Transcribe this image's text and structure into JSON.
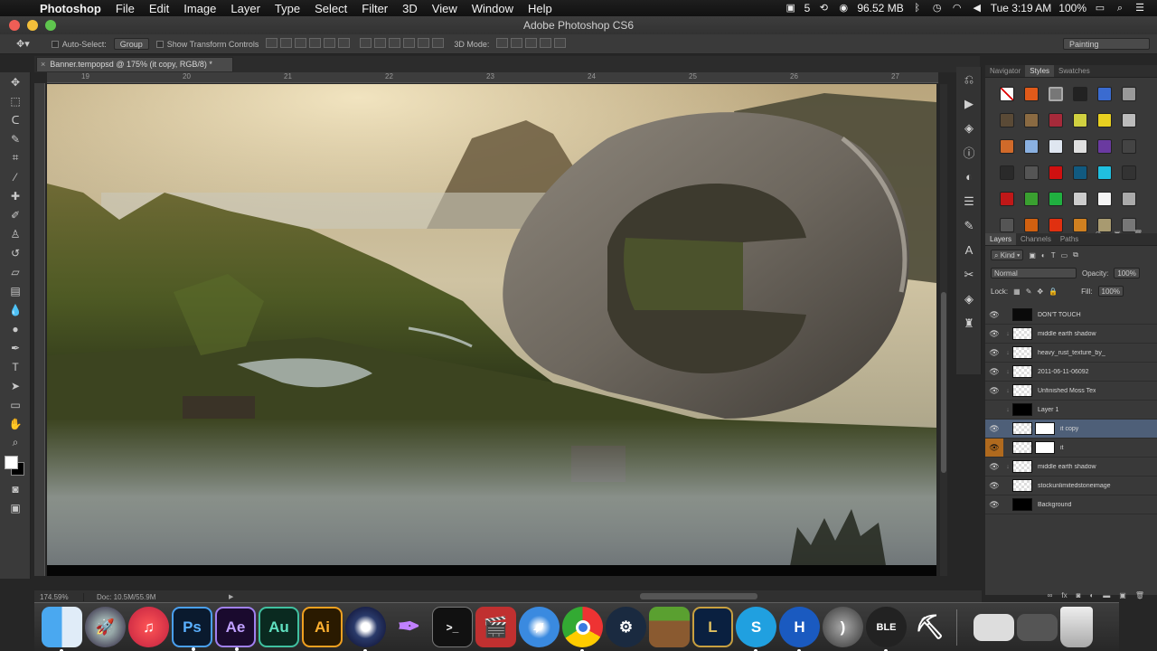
{
  "menubar": {
    "apple": "",
    "app": "Photoshop",
    "items": [
      "File",
      "Edit",
      "Image",
      "Layer",
      "Type",
      "Select",
      "Filter",
      "3D",
      "View",
      "Window",
      "Help"
    ],
    "status": {
      "count": "5",
      "memory": "96.52 MB",
      "clock": "Tue 3:19 AM",
      "battery": "100%"
    }
  },
  "window": {
    "title": "Adobe Photoshop CS6"
  },
  "options": {
    "auto_select": "Auto-Select:",
    "group": "Group",
    "show_transform": "Show Transform Controls",
    "three_d": "3D Mode:",
    "workspace": "Painting"
  },
  "document": {
    "tab": "Banner.tempopsd @ 175% (it copy, RGB/8) *"
  },
  "ruler": {
    "top": [
      "19",
      "20",
      "21",
      "22",
      "23",
      "24",
      "25",
      "26",
      "27"
    ]
  },
  "status": {
    "zoom": "174.59%",
    "doc": "Doc: 10.5M/55.9M"
  },
  "panels": {
    "top_tabs": [
      "Navigator",
      "Styles",
      "Swatches"
    ],
    "active_top": "Styles",
    "layer_tabs": [
      "Layers",
      "Channels",
      "Paths"
    ],
    "kind": "Kind",
    "blend": "Normal",
    "opacity_label": "Opacity:",
    "opacity": "100%",
    "lock_label": "Lock:",
    "fill_label": "Fill:",
    "fill": "100%"
  },
  "layers": [
    {
      "name": "DON'T TOUCH",
      "thumb": "dark",
      "brush": false
    },
    {
      "name": "middle earth shadow",
      "thumb": "check",
      "brush": true
    },
    {
      "name": "heavy_rust_texture_by_",
      "thumb": "check",
      "brush": true
    },
    {
      "name": "2011-06-11-06092",
      "thumb": "check",
      "brush": true
    },
    {
      "name": "Unfinished Moss Tex",
      "thumb": "check",
      "brush": true
    },
    {
      "name": "Layer 1",
      "thumb": "black",
      "brush": true
    },
    {
      "name": "it copy",
      "thumb": "mask",
      "brush": false,
      "selected": true
    },
    {
      "name": "it",
      "thumb": "mask",
      "brush": false,
      "orange": true
    },
    {
      "name": "middle earth shadow",
      "thumb": "check",
      "brush": true
    },
    {
      "name": "stockunlimitedstoneimage",
      "thumb": "check",
      "brush": false
    },
    {
      "name": "Background",
      "thumb": "black",
      "brush": false
    }
  ],
  "dock": [
    "Finder",
    "Launchpad",
    "iTunes",
    "Ps",
    "Ae",
    "Au",
    "Ai",
    "Cinema 4D",
    "Feather",
    "Terminal",
    "Photo Booth",
    "Safari",
    "Chrome",
    "Steam",
    "Minecraft",
    "L",
    "S",
    "H",
    "Wacom",
    "BLE",
    "Sketch",
    "Preview",
    "Notes",
    "Trash"
  ]
}
